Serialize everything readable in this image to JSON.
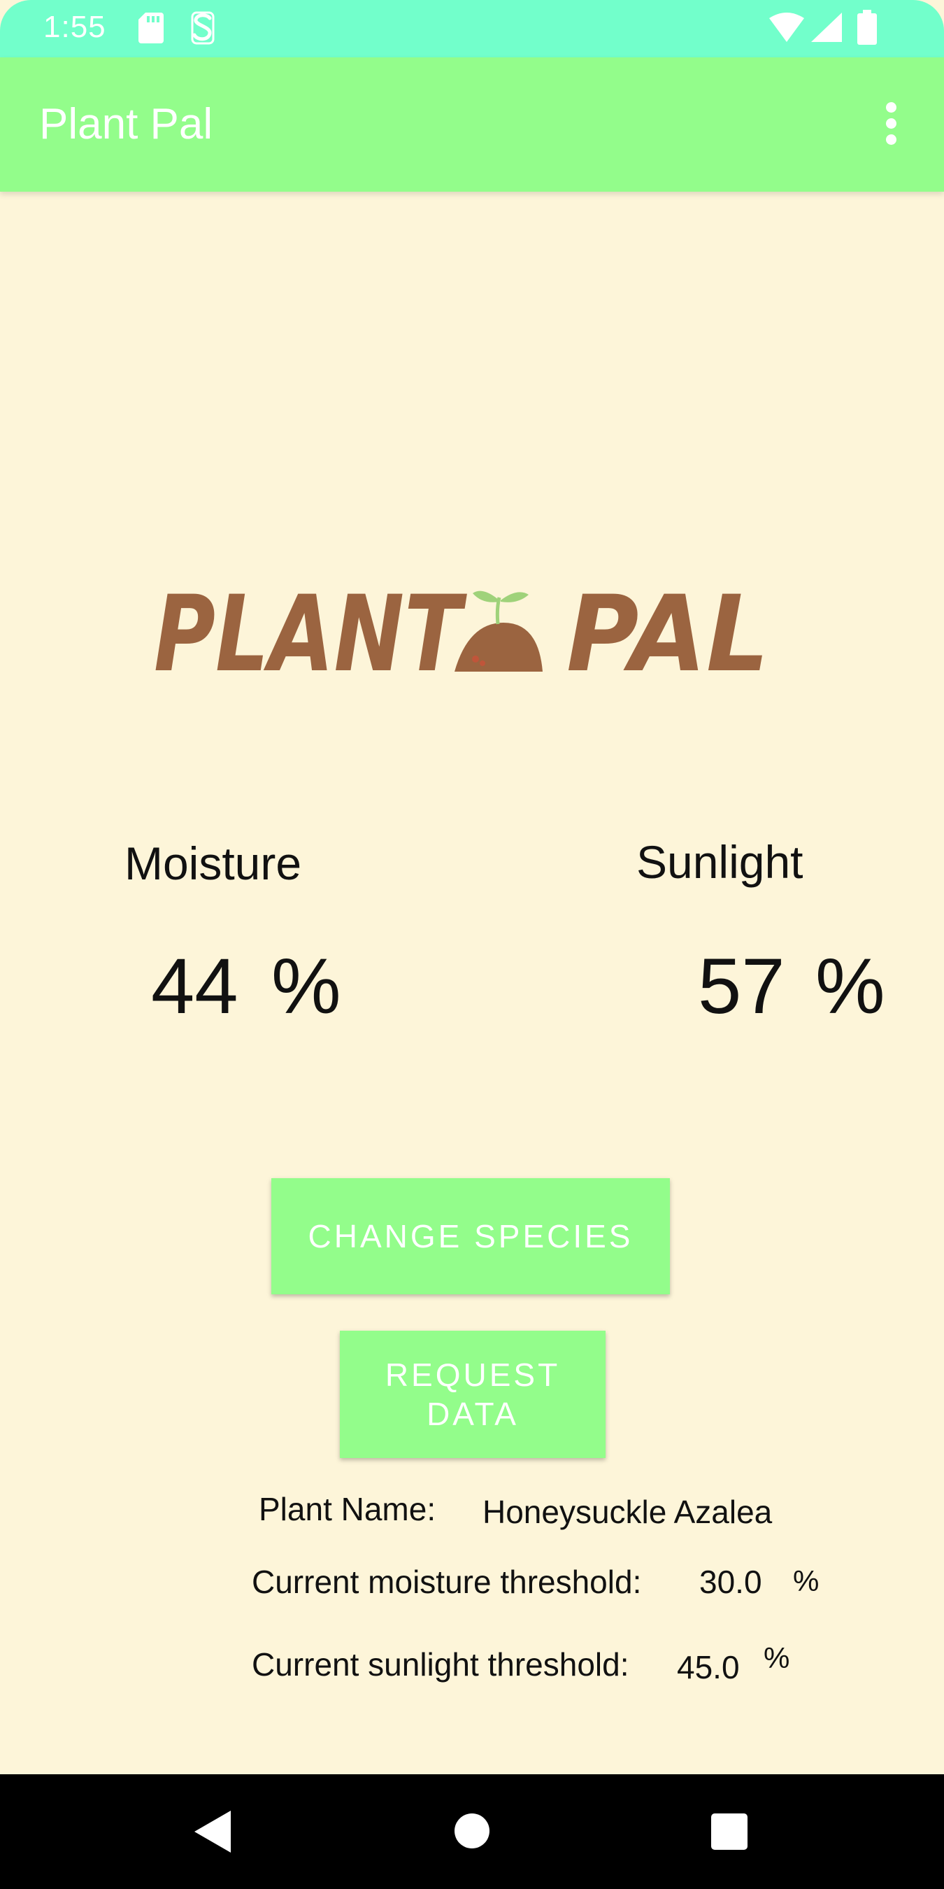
{
  "status_bar": {
    "time": "1:55",
    "icons": [
      "sd-card-icon",
      "s-app-icon",
      "wifi-icon",
      "signal-icon",
      "battery-icon"
    ]
  },
  "app_bar": {
    "title": "Plant Pal",
    "menu_icon": "more-vert-icon"
  },
  "logo": {
    "text_left": "PLANT",
    "text_right": "PAL"
  },
  "readings": {
    "moisture": {
      "label": "Moisture",
      "value": "44",
      "unit": "%"
    },
    "sunlight": {
      "label": "Sunlight",
      "value": "57",
      "unit": "%"
    }
  },
  "buttons": {
    "change_species": "CHANGE SPECIES",
    "request_data": "REQUEST DATA"
  },
  "plant_info": {
    "name_label": "Plant Name:",
    "name_value": "Honeysuckle Azalea",
    "moisture_threshold_label": "Current moisture threshold:",
    "moisture_threshold_value": "30.0",
    "moisture_threshold_unit": "%",
    "sunlight_threshold_label": "Current sunlight threshold:",
    "sunlight_threshold_value": "45.0",
    "sunlight_threshold_unit": "%"
  },
  "nav_bar": {
    "icons": [
      "back-icon",
      "home-icon",
      "recents-icon"
    ]
  },
  "colors": {
    "status_bar": "#72ffcb",
    "app_bar": "#93fd8b",
    "background": "#fdf5d9",
    "logo_brown": "#9b6440",
    "button": "#93fd8b"
  }
}
